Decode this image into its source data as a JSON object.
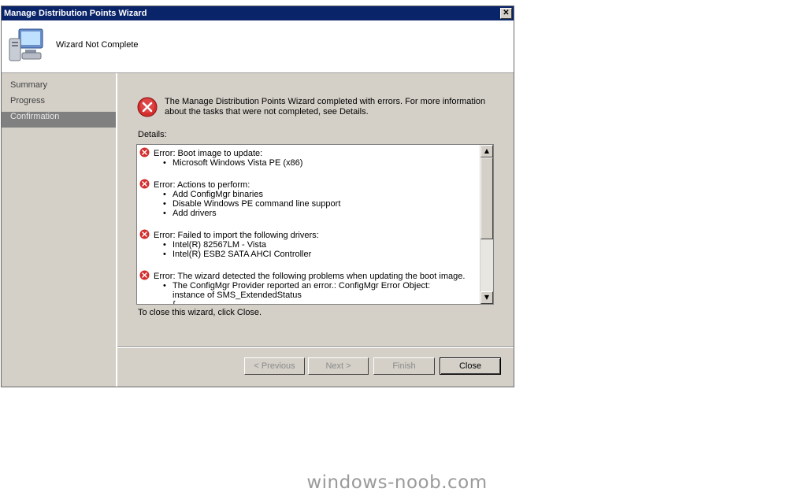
{
  "window": {
    "title": "Manage Distribution Points Wizard",
    "close_glyph": "✕"
  },
  "header": {
    "title": "Wizard Not Complete",
    "icon": "computer-icon"
  },
  "sidebar": {
    "items": [
      {
        "label": "Summary",
        "active": false
      },
      {
        "label": "Progress",
        "active": false
      },
      {
        "label": "Confirmation",
        "active": true
      }
    ]
  },
  "content": {
    "status_icon": "error-icon",
    "status_message": "The Manage Distribution Points Wizard completed with errors. For more information about the tasks that were not completed, see Details.",
    "details_label": "Details:",
    "errors": [
      {
        "title": "Error: Boot image to update:",
        "items": [
          "Microsoft Windows Vista PE (x86)"
        ]
      },
      {
        "title": "Error: Actions to perform:",
        "items": [
          "Add ConfigMgr binaries",
          "Disable Windows PE command line support",
          "Add drivers"
        ]
      },
      {
        "title": "Error: Failed to import the following drivers:",
        "items": [
          "Intel(R) 82567LM - Vista",
          "Intel(R) ESB2 SATA AHCI Controller"
        ]
      },
      {
        "title": "Error: The wizard detected the following problems when updating the boot image.",
        "items": [
          "The ConfigMgr Provider reported an error.: ConfigMgr Error Object:"
        ],
        "continuation": [
          "instance of SMS_ExtendedStatus",
          "{"
        ]
      }
    ],
    "close_hint": "To close this wizard, click Close."
  },
  "buttons": {
    "previous": "< Previous",
    "next": "Next >",
    "finish": "Finish",
    "close": "Close"
  },
  "footer": {
    "watermark": "windows-noob.com"
  },
  "colors": {
    "titlebar": "#0a246a",
    "error": "#d32f2f",
    "chrome": "#d4d0c8"
  }
}
